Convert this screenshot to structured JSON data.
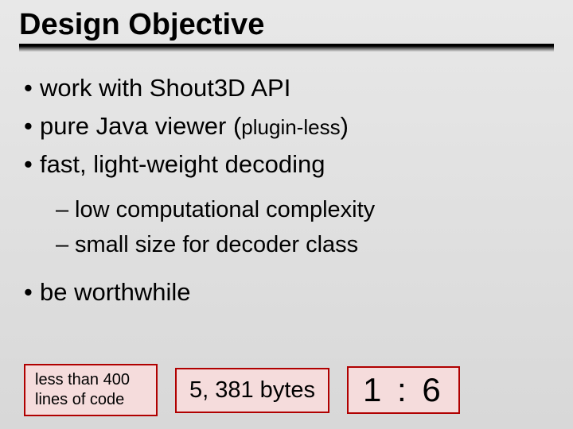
{
  "title": "Design Objective",
  "bullets": {
    "b1": "work with Shout3D API",
    "b2_pre": "pure Java viewer (",
    "b2_paren": "plugin-less",
    "b2_post": ")",
    "b3": "fast, light-weight decoding",
    "b4": "be worthwhile"
  },
  "sub_bullets": {
    "s1": "low computational complexity",
    "s2": "small size for decoder class"
  },
  "boxes": {
    "lines_label_1": "less than 400",
    "lines_label_2": "lines of code",
    "bytes_label": "5, 381 bytes",
    "ratio_label": "1 : 6"
  }
}
